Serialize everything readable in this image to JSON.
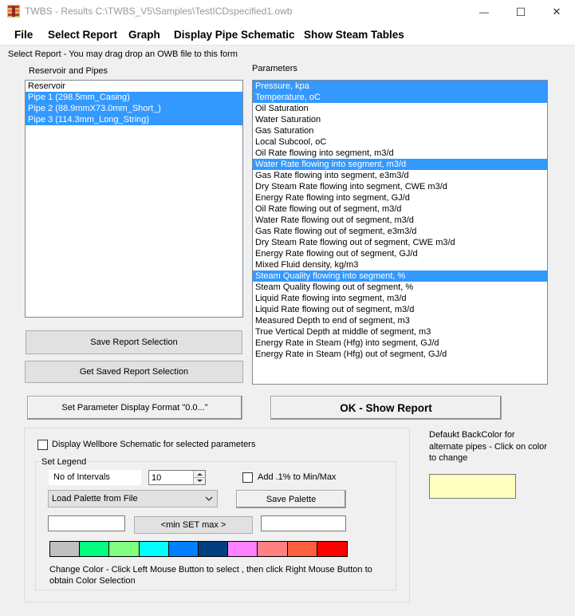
{
  "window": {
    "title": "TWBS - Results C:\\TWBS_V5\\Samples\\TestICDspecified1.owb",
    "minimize_glyph": "—",
    "maximize_glyph": "☐",
    "close_glyph": "✕"
  },
  "menu": [
    "File",
    "Select Report",
    "Graph",
    "Display Pipe Schematic",
    "Show Steam Tables"
  ],
  "instruction": "Select Report - You may drag drop an OWB file to this form",
  "reservoir_pipes": {
    "label": "Reservoir and Pipes",
    "items": [
      {
        "text": "Reservoir",
        "selected": false
      },
      {
        "text": "Pipe 1 (298.5mm_Casing)",
        "selected": true
      },
      {
        "text": "Pipe 2 (88.9mmX73.0mm_Short_)",
        "selected": true
      },
      {
        "text": "Pipe 3 (114.3mm_Long_String)",
        "selected": true
      }
    ]
  },
  "parameters": {
    "label": "Parameters",
    "items": [
      {
        "text": "Pressure, kpa",
        "selected": true
      },
      {
        "text": "Temperature, oC",
        "selected": true
      },
      {
        "text": "Oil Saturation",
        "selected": false
      },
      {
        "text": "Water Saturation",
        "selected": false
      },
      {
        "text": "Gas Saturation",
        "selected": false
      },
      {
        "text": "Local Subcool, oC",
        "selected": false
      },
      {
        "text": "Oil Rate flowing into segment, m3/d",
        "selected": false
      },
      {
        "text": "Water Rate flowing into segment, m3/d",
        "selected": true
      },
      {
        "text": "Gas Rate flowing into segment, e3m3/d",
        "selected": false
      },
      {
        "text": "Dry Steam Rate flowing into segment, CWE m3/d",
        "selected": false
      },
      {
        "text": "Energy Rate flowing into segment, GJ/d",
        "selected": false
      },
      {
        "text": "Oil Rate flowing out of segment, m3/d",
        "selected": false
      },
      {
        "text": "Water Rate flowing out of segment, m3/d",
        "selected": false
      },
      {
        "text": "Gas Rate flowing out of segment, e3m3/d",
        "selected": false
      },
      {
        "text": "Dry Steam Rate flowing out of segment, CWE m3/d",
        "selected": false
      },
      {
        "text": "Energy Rate flowing out of segment, GJ/d",
        "selected": false
      },
      {
        "text": "Mixed Fluid density, kg/m3",
        "selected": false
      },
      {
        "text": "Steam Quality flowing into segment, %",
        "selected": true
      },
      {
        "text": "Steam Quality flowing out of segment, %",
        "selected": false
      },
      {
        "text": "Liquid Rate flowing into segment, m3/d",
        "selected": false
      },
      {
        "text": "Liquid Rate flowing out of segment, m3/d",
        "selected": false
      },
      {
        "text": "Measured Depth to end of segment, m3",
        "selected": false
      },
      {
        "text": "True Vertical Depth at middle of segment, m3",
        "selected": false
      },
      {
        "text": "Energy Rate in Steam (Hfg) into segment, GJ/d",
        "selected": false
      },
      {
        "text": "Energy Rate in Steam (Hfg) out of segment, GJ/d",
        "selected": false
      }
    ]
  },
  "buttons": {
    "save_report": "Save Report Selection",
    "get_saved_report": "Get Saved Report Selection",
    "set_format": "Set Parameter Display Format \"0.0...\"",
    "ok_show": "OK - Show Report",
    "save_palette": "Save Palette",
    "min_set_max": "<min  SET max >"
  },
  "display_schematic_label": "Display Wellbore Schematic for selected parameters",
  "legend": {
    "group_label": "Set Legend",
    "intervals_label": "No of Intervals",
    "intervals_value": "10",
    "add_label": "Add .1% to Min/Max",
    "palette_combo": "Load Palette from File",
    "min_value": "",
    "max_value": "",
    "colors": [
      "#c0c0c0",
      "#00ff80",
      "#80ff80",
      "#00ffff",
      "#0080ff",
      "#004080",
      "#ff80ff",
      "#ff8080",
      "#ff6040",
      "#ff0000"
    ],
    "change_color_note": "Change Color - Click Left Mouse Button to select , then click Right Mouse Button to obtain Color Selection"
  },
  "backcolor": {
    "label": "Defaukt BackColor for alternate pipes - Click on color to change",
    "color": "#ffffc0"
  }
}
